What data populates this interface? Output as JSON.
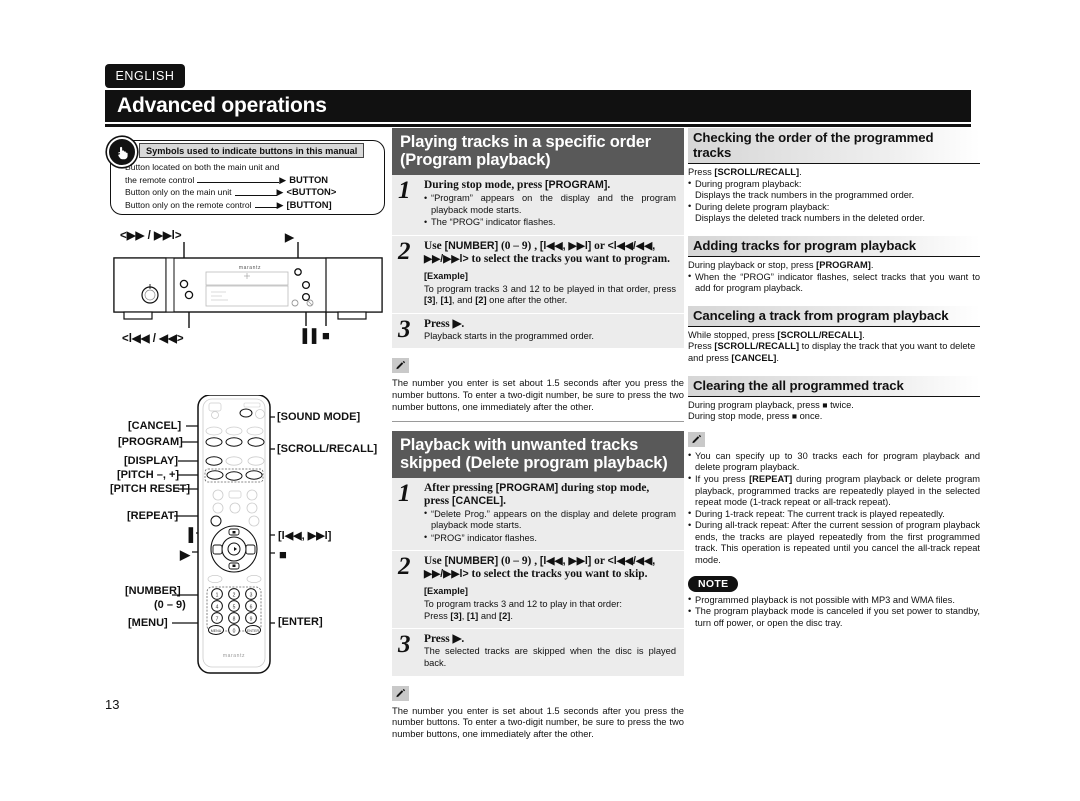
{
  "lang_tab": "ENGLISH",
  "page_title": "Advanced operations",
  "page_number": "13",
  "symbols_box": {
    "icon": "pointing-hand-icon",
    "title": "Symbols used to indicate buttons in this manual",
    "rows": [
      {
        "text_line1": "Button located on both the main unit and",
        "text_line2": "the remote control",
        "arrow": "▶",
        "code": "BUTTON"
      },
      {
        "text_line1": "Button only on the main unit",
        "text_line2": "",
        "arrow": "▶",
        "code": "<BUTTON>"
      },
      {
        "text_line1": "Button only on the remote control",
        "text_line2": "",
        "arrow": "▶",
        "code": "[BUTTON]"
      }
    ]
  },
  "main_unit_diagram": {
    "label_top_left": "<▶▶ / ▶▶l>",
    "label_bottom_left": "<l◀◀ / ◀◀>",
    "label_top_right": "▶",
    "label_pause": "▐▐",
    "label_stop": "■",
    "brand": "marantz"
  },
  "remote_diagram": {
    "labels_left": [
      "[CANCEL]",
      "[PROGRAM]",
      "[DISPLAY]",
      "[PITCH –, +]",
      "[PITCH RESET]",
      "[REPEAT]",
      "[NUMBER]",
      "(0 – 9)",
      "[MENU]"
    ],
    "labels_right": [
      "[SOUND MODE]",
      "[SCROLL/RECALL]",
      "[l◀◀, ▶▶l]",
      "[ENTER]"
    ],
    "glyph_pause": "▐▐",
    "glyph_play": "▶",
    "glyph_stop": "■",
    "brand": "marantz"
  },
  "section_program": {
    "heading_line1": "Playing tracks in a specific order",
    "heading_line2": "(Program playback)",
    "steps": [
      {
        "num": "1",
        "title_parts": [
          {
            "t": "During stop mode, press ",
            "bold_bracket": false
          },
          {
            "t": "[PROGRAM]",
            "bold_bracket": true
          },
          {
            "t": ".",
            "bold_bracket": false
          }
        ],
        "bullets": [
          "“Program” appears on the display and the program playback mode starts.",
          "The “PROG” indicator flashes."
        ]
      },
      {
        "num": "2",
        "title_text": "Use [NUMBER] (0 – 9) , [l◀◀, ▶▶l] or <l◀◀/◀◀, ▶▶/▶▶l> to select the tracks you want to program.",
        "example_label": "[Example]",
        "example_text": "To program tracks 3 and 12 to be played in that order, press [3], [1], and [2] one after the other."
      },
      {
        "num": "3",
        "title_text": "Press ▶.",
        "plain_text": "Playback starts in the programmed order."
      }
    ],
    "tip_text": "The number you enter is set about 1.5 seconds after you press the number buttons. To enter a two-digit number, be sure to press the two number buttons, one immediately after the other."
  },
  "section_delete": {
    "heading_line1": "Playback with unwanted tracks",
    "heading_line2": "skipped (Delete program playback)",
    "steps": [
      {
        "num": "1",
        "title_text": "After pressing [PROGRAM] during stop mode, press [CANCEL].",
        "bullets": [
          "“Delete Prog.” appears on the display and delete program playback mode starts.",
          "“PROG” indicator flashes."
        ]
      },
      {
        "num": "2",
        "title_text": "Use [NUMBER] (0 – 9) , [l◀◀, ▶▶l] or <l◀◀/◀◀, ▶▶/▶▶l> to select the tracks you want to skip.",
        "example_label": "[Example]",
        "example_text_line1": "To program tracks 3 and 12 to play in that order:",
        "example_text_line2": "Press [3], [1] and [2]."
      },
      {
        "num": "3",
        "title_text": "Press ▶.",
        "plain_text": "The selected tracks are skipped when the disc is played back."
      }
    ],
    "tip_text": "The number you enter is set about 1.5 seconds after you press the number buttons. To enter a two-digit number, be sure to press the two number buttons, one immediately after the other."
  },
  "right_column": {
    "checking": {
      "heading": "Checking the order of the programmed tracks",
      "intro": "Press [SCROLL/RECALL].",
      "items": [
        {
          "bullet": "During program playback:",
          "sub": "Displays the track numbers in the programmed order."
        },
        {
          "bullet": "During delete program playback:",
          "sub": "Displays the deleted track numbers in the deleted order."
        }
      ]
    },
    "adding": {
      "heading": "Adding tracks for program playback",
      "intro": "During playback or stop, press [PROGRAM].",
      "bullets": [
        "When the “PROG” indicator flashes, select tracks that you want to add for program playback."
      ]
    },
    "canceling": {
      "heading": "Canceling a track from program playback",
      "line1": "While stopped, press [SCROLL/RECALL].",
      "line2": "Press [SCROLL/RECALL] to display the track that you want to delete and press [CANCEL]."
    },
    "clearing": {
      "heading": "Clearing the all programmed track",
      "line1": "During program playback, press ■ twice.",
      "line2": "During stop mode, press ■ once."
    },
    "tips": [
      "You can specify up to 30 tracks each for program playback and delete program playback.",
      "If you press [REPEAT] during program playback or delete program playback, programmed tracks are repeatedly played in the selected repeat mode (1-track repeat or all-track repeat).",
      "During 1-track repeat: The current track is played repeatedly.",
      "During all-track repeat: After the current session of program playback ends, the tracks are played repeatedly from the first programmed track. This operation is repeated until you cancel the all-track repeat mode."
    ],
    "note": {
      "badge": "NOTE",
      "items": [
        "Programmed playback is not possible with MP3 and WMA files.",
        "The program playback mode is canceled if you set power to standby, turn off power, or open the disc tray."
      ]
    }
  },
  "colors": {
    "title_bar": "#111111",
    "section_head_bg": "#595959",
    "step_bg": "#ececec",
    "sub_head_bg": "#d6d6d6",
    "tip_icon_bg": "#c9c9c9"
  }
}
